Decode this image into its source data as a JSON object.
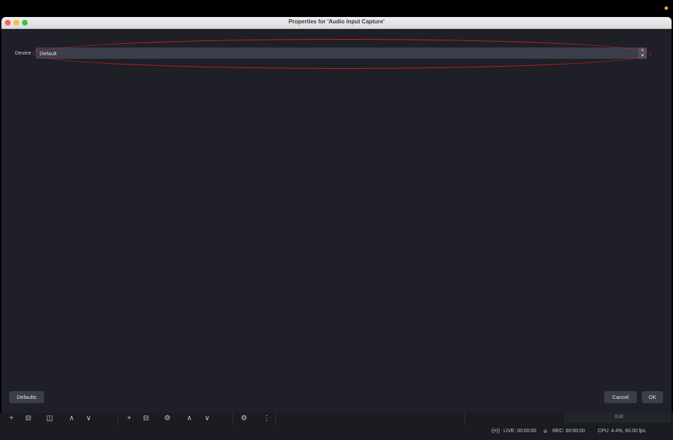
{
  "dialog": {
    "title": "Properties for 'Audio Input Capture'"
  },
  "device": {
    "label": "Device",
    "selected": "Default"
  },
  "buttons": {
    "defaults": "Defaults",
    "cancel": "Cancel",
    "ok": "OK"
  },
  "dock": {
    "exit_label": "Exit"
  },
  "status": {
    "live": "LIVE: 00:00:00",
    "rec": "REC: 00:00:00",
    "cpu": "CPU: 4.4%, 60.00 fps"
  },
  "icons": {
    "add": "+",
    "delete": "⊟",
    "filters": "◫",
    "up": "∧",
    "down": "∨",
    "gear": "⚙",
    "more": "⋮",
    "live": "((•))",
    "rec": "⊘"
  },
  "colors": {
    "window_bg": "#1e1f27",
    "control_bg": "#3b3e4a",
    "highlight": "#d21f1f",
    "notification": "#e8a52a"
  }
}
